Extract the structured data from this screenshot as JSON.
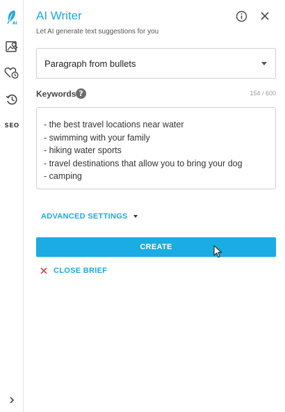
{
  "header": {
    "title": "AI Writer",
    "subtitle": "Let AI generate text suggestions for you"
  },
  "rail": {
    "items": [
      {
        "icon": "ai-feather-icon"
      },
      {
        "icon": "image-search-icon"
      },
      {
        "icon": "heart-clock-icon"
      },
      {
        "icon": "history-icon"
      },
      {
        "icon": "seo-icon",
        "label": "SEO"
      }
    ]
  },
  "mode_select": {
    "value": "Paragraph from bullets"
  },
  "keywords": {
    "label": "Keywords",
    "counter": "154 / 600",
    "lines": [
      "- the best travel locations near water",
      "- swimming with your family",
      "- hiking water sports",
      "- travel destinations that allow you to bring your dog",
      "- camping"
    ]
  },
  "advanced_settings_label": "ADVANCED SETTINGS",
  "create_label": "CREATE",
  "close_brief_label": "CLOSE BRIEF",
  "colors": {
    "accent": "#1fa8df",
    "button": "#1aace2",
    "danger": "#e04848"
  }
}
